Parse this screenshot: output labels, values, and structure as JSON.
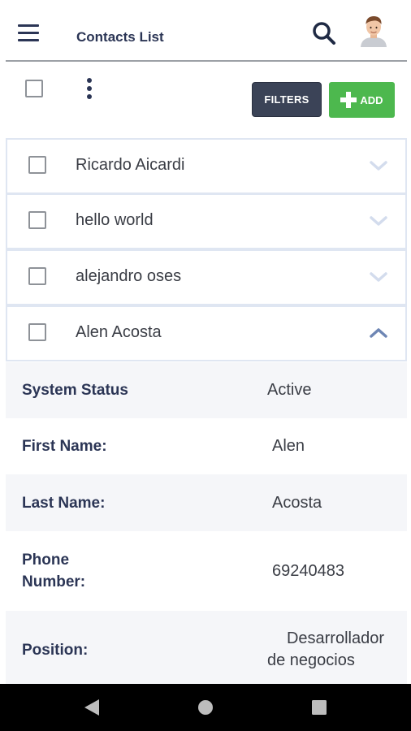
{
  "header": {
    "title": "Contacts List",
    "icons": [
      "menu-icon",
      "search-icon",
      "avatar"
    ]
  },
  "toolbar": {
    "filters_label": "FILTERS",
    "add_label": "ADD",
    "add_color": "#4db84e",
    "filters_color": "#3b4357"
  },
  "contacts": [
    {
      "name": "Ricardo Aicardi",
      "expanded": false
    },
    {
      "name": "hello world",
      "expanded": false
    },
    {
      "name": "alejandro oses",
      "expanded": false
    },
    {
      "name": "Alen Acosta",
      "expanded": true
    }
  ],
  "details": {
    "system_status": {
      "label": "System Status",
      "value": "Active"
    },
    "first_name": {
      "label": "First Name:",
      "value": "Alen"
    },
    "last_name": {
      "label": "Last Name:",
      "value": "Acosta"
    },
    "phone": {
      "label_line1": "Phone",
      "label_line2": "Number:",
      "value": "69240483"
    },
    "position": {
      "label": "Position:",
      "value_line1": "Desarrollador",
      "value_line2": "de negocios"
    }
  },
  "navbar": {
    "buttons": [
      "back-icon",
      "home-icon",
      "recents-icon"
    ]
  }
}
